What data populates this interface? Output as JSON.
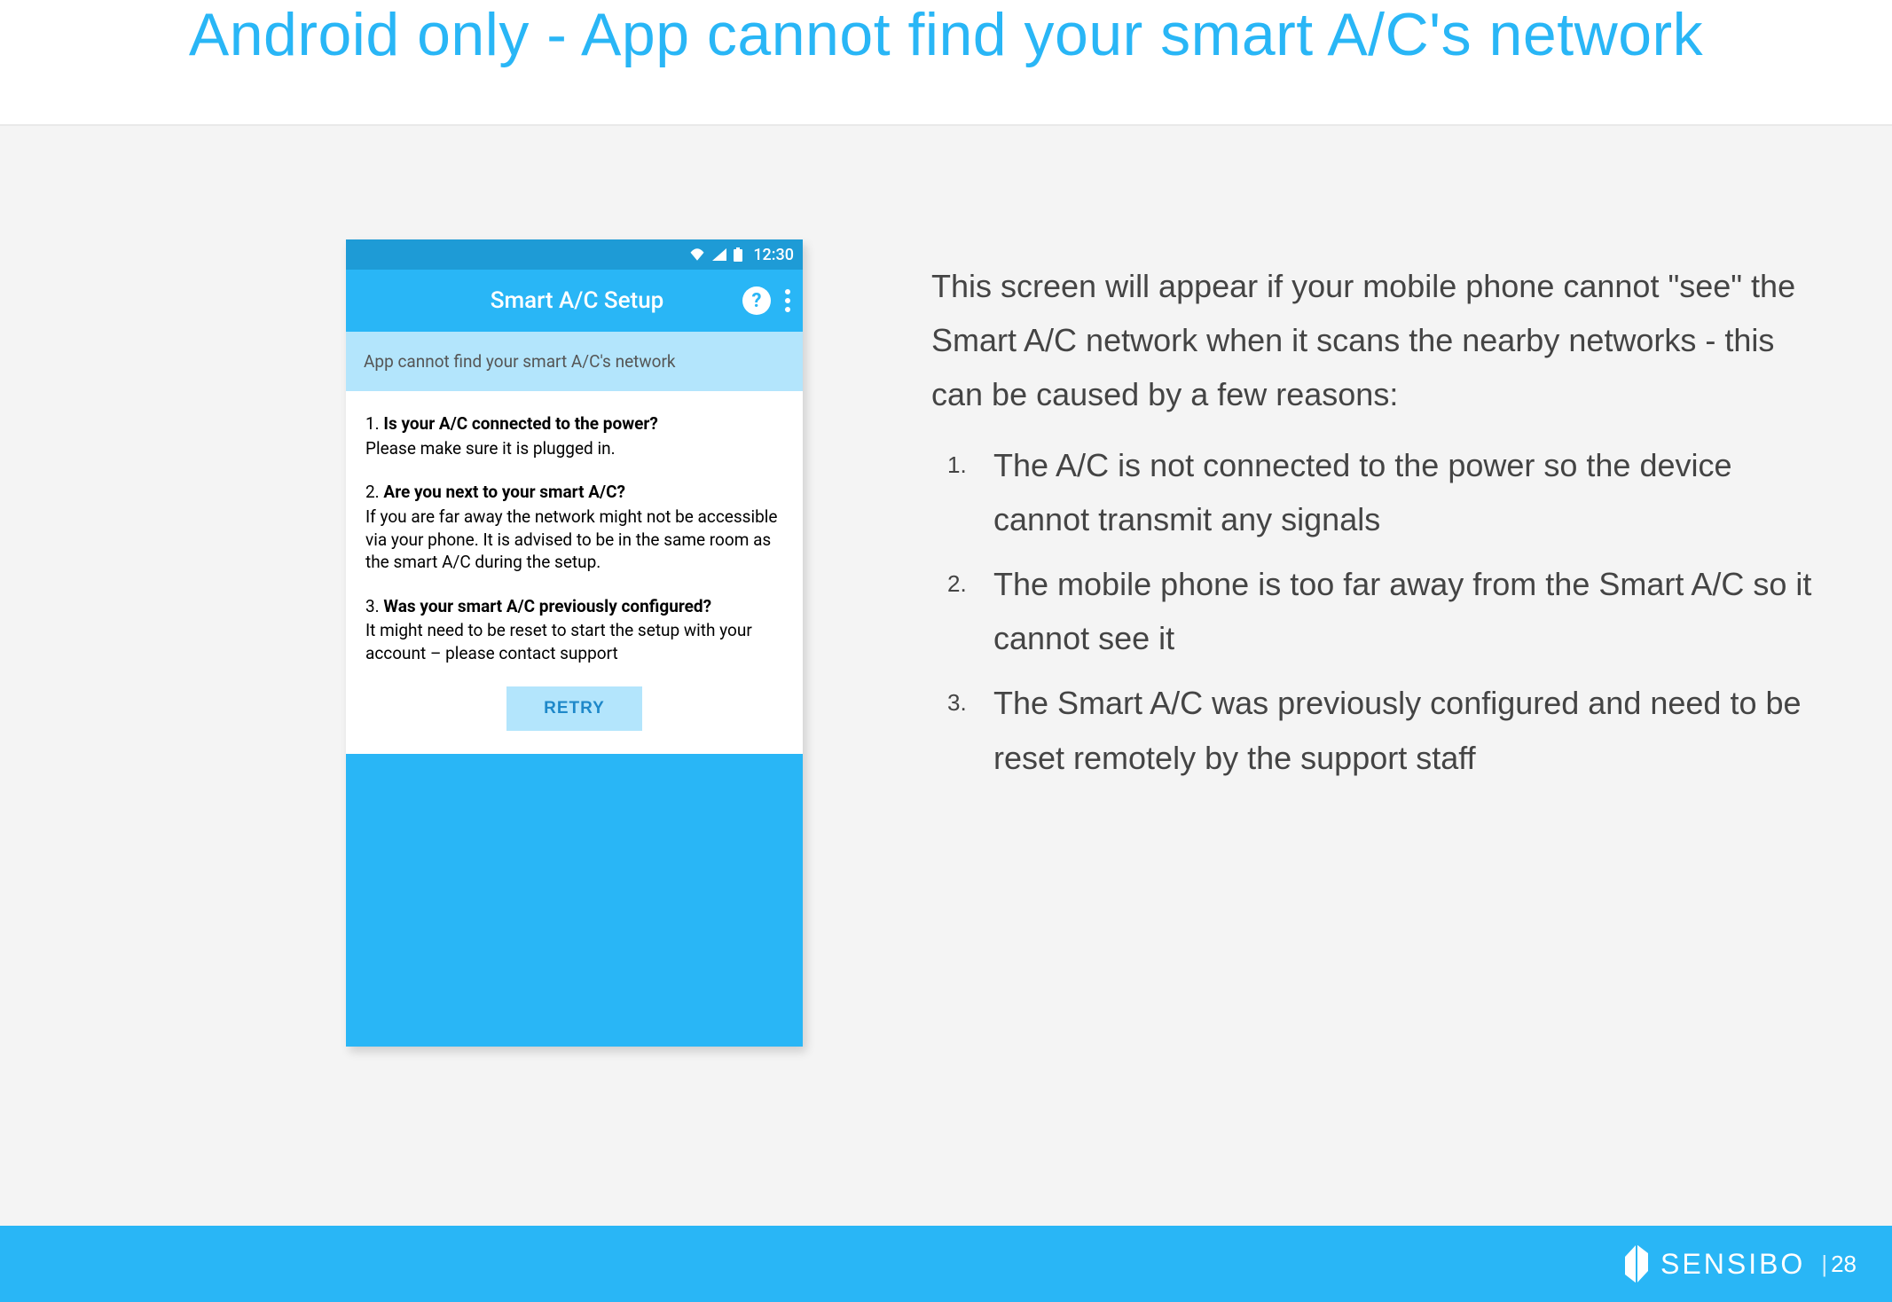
{
  "slide": {
    "title": "Android only - App cannot find your smart A/C's network"
  },
  "phone": {
    "status": {
      "time": "12:30"
    },
    "appbar": {
      "title": "Smart A/C Setup",
      "help_label": "?"
    },
    "banner": "App cannot find your smart A/C's network",
    "tips": [
      {
        "num": "1.",
        "question": "Is your A/C connected to the power?",
        "body": "Please make sure it is plugged in."
      },
      {
        "num": "2.",
        "question": "Are you next to your smart A/C?",
        "body": "If you are far away the network might not be accessible via your phone. It is advised to be in the same room as the smart A/C during the setup."
      },
      {
        "num": "3.",
        "question": "Was your smart A/C previously configured?",
        "body": "It might need to be reset to start the setup with your account – please contact support"
      }
    ],
    "retry_label": "RETRY"
  },
  "description": {
    "intro": "This screen will appear if your mobile phone cannot \"see\" the Smart A/C network when it scans the nearby networks - this can be caused by a few reasons:",
    "reasons": [
      "The A/C is not connected to the power so the device cannot transmit any signals",
      "The mobile phone is too far away from the Smart A/C so it cannot see it",
      "The Smart A/C was previously configured and need to be reset remotely by the support staff"
    ]
  },
  "footer": {
    "brand": "SENSIBO",
    "page_prefix": "|",
    "page_number": "28"
  }
}
